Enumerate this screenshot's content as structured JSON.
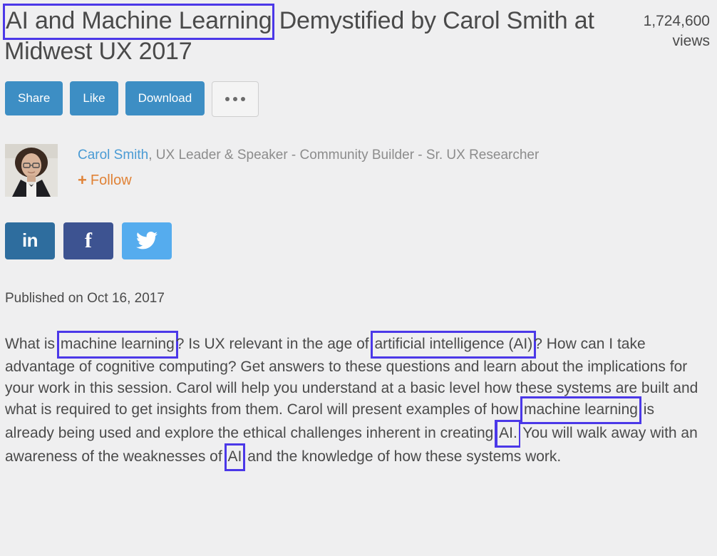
{
  "page": {
    "background": "#efeff0",
    "highlight_color": "#4b38e8",
    "primary_button_color": "#3d8ec4"
  },
  "header": {
    "title_highlighted": "AI and Machine Learning",
    "title_rest": "Demystified by Carol Smith at Midwest UX 2017",
    "views_count": "1,724,600",
    "views_label": "views"
  },
  "actions": {
    "share_label": "Share",
    "like_label": "Like",
    "download_label": "Download",
    "more_label": "•••"
  },
  "author": {
    "name": "Carol Smith",
    "bio": ", UX Leader & Speaker - Community Builder - Sr. UX Researcher",
    "follow_label": "Follow",
    "follow_plus": "+",
    "avatar_alt": "Carol Smith portrait"
  },
  "social": {
    "linkedin_label": "in",
    "facebook_label": "f",
    "twitter_label": "twitter-bird"
  },
  "meta": {
    "published": "Published on Oct 16, 2017"
  },
  "description": {
    "seg_1": "What is ",
    "hl_1": "machine learning",
    "seg_2": "? Is UX relevant in the age of ",
    "hl_2": "artificial intelligence (AI)",
    "seg_3": "? How can I take advantage of cognitive computing? Get answers to these questions and learn about the implications for your work in this session. Carol will help you understand at a basic level how these systems are built and what is required to get insights from them. Carol will present examples of how ",
    "hl_3": "machine learning",
    "seg_4": " is already being used and explore the ethical challenges inherent in creating ",
    "hl_4": "AI.",
    "seg_5": " You will walk away with an awareness of the weaknesses of ",
    "hl_5": "AI",
    "seg_6": " and the knowledge of how these systems work."
  }
}
